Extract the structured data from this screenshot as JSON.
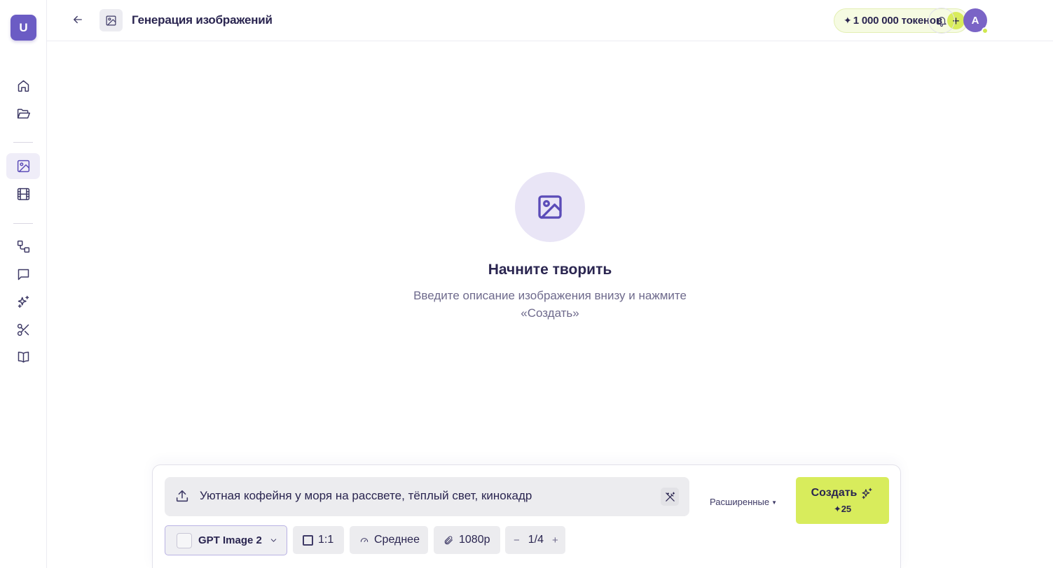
{
  "app": {
    "logo_letter": "U"
  },
  "sidebar": {
    "items": [
      {
        "name": "home",
        "icon": "home-icon",
        "active": false
      },
      {
        "name": "folder",
        "icon": "folder-open-icon",
        "active": false
      },
      {
        "name": "images",
        "icon": "image-icon",
        "active": true
      },
      {
        "name": "video",
        "icon": "film-icon",
        "active": false
      },
      {
        "name": "workflow",
        "icon": "workflow-icon",
        "active": false
      },
      {
        "name": "chat",
        "icon": "chat-icon",
        "active": false
      },
      {
        "name": "sparkles",
        "icon": "sparkles-icon",
        "active": false
      },
      {
        "name": "cut",
        "icon": "scissors-icon",
        "active": false
      },
      {
        "name": "library",
        "icon": "book-icon",
        "active": false
      }
    ]
  },
  "header": {
    "title": "Генерация изображений",
    "tokens_star": "✦",
    "tokens_label": "1 000 000 токенов",
    "tokens_add": "+",
    "avatar_letter": "A"
  },
  "empty_state": {
    "title": "Начните творить",
    "description": "Введите описание изображения внизу и нажмите «Создать»"
  },
  "composer": {
    "prompt_value": "Уютная кофейня у моря на рассвете, тёплый свет, кинокадр",
    "advanced_label": "Расширенные",
    "create_label": "Создать",
    "create_cost": "✦25",
    "model": "GPT Image 2",
    "aspect_ratio": "1:1",
    "quality": "Среднее",
    "resolution": "1080p",
    "count": "1/4",
    "count_minus": "−",
    "count_plus": "+"
  },
  "colors": {
    "accent": "#6b5cc4",
    "create_button": "#d8ec5c",
    "active_nav_bg": "#efedf8"
  }
}
